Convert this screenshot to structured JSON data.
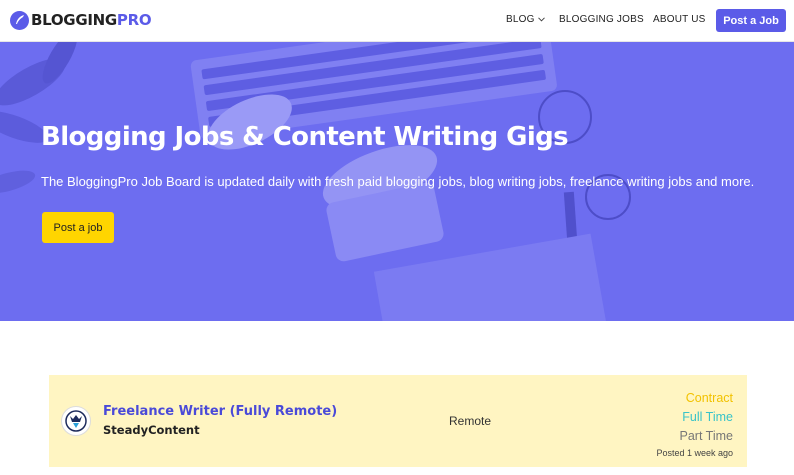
{
  "brand": {
    "name_a": "BLOGGING",
    "name_b": "PRO",
    "accent": "#5b5be8"
  },
  "nav": {
    "items": [
      {
        "label": "BLOG",
        "has_dropdown": true
      },
      {
        "label": "BLOGGING JOBS"
      },
      {
        "label": "ABOUT US"
      }
    ],
    "cta_label": "Post a Job"
  },
  "hero": {
    "title": "Blogging Jobs & Content Writing Gigs",
    "subtitle": "The BloggingPro Job Board is updated daily with fresh paid blogging jobs, blog writing jobs, freelance writing jobs and more.",
    "button_label": "Post a job",
    "button_color": "#ffd500"
  },
  "jobs": [
    {
      "title": "Freelance Writer (Fully Remote)",
      "company": "SteadyContent",
      "location": "Remote",
      "types": [
        "Contract",
        "Full Time",
        "Part Time"
      ],
      "posted": "Posted 1 week ago",
      "card_color": "#fff5c2"
    }
  ],
  "icons": {
    "logo": "feather-icon",
    "dropdown": "chevron-down-icon",
    "company": "company-logo-icon"
  }
}
